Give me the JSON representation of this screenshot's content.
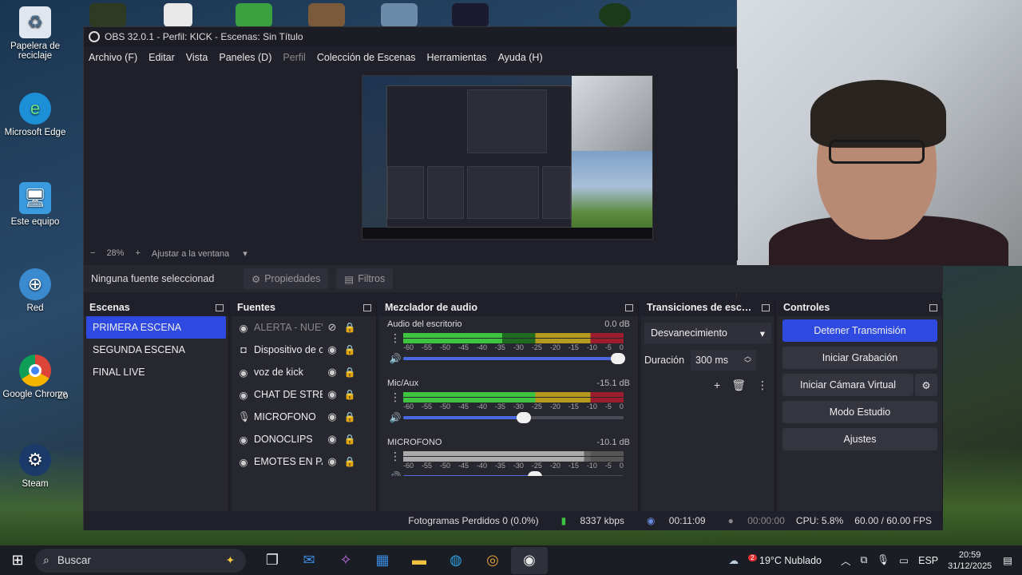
{
  "desktop": {
    "icons": [
      {
        "label": "Papelera de reciclaje",
        "icon": "recycle-bin-icon"
      },
      {
        "label": "Microsoft Edge",
        "icon": "edge-icon"
      },
      {
        "label": "Este equipo",
        "icon": "computer-icon"
      },
      {
        "label": "Red",
        "icon": "network-icon"
      },
      {
        "label": "Google Chrome",
        "icon": "chrome-icon"
      },
      {
        "label": "Steam",
        "icon": "steam-icon"
      }
    ],
    "partial_label": "Zo"
  },
  "obs": {
    "title": "OBS 32.0.1 - Perfil: KICK - Escenas: Sin Título",
    "menu": [
      "Archivo (F)",
      "Editar",
      "Vista",
      "Paneles (D)",
      "Perfil",
      "Colección de Escenas",
      "Herramientas",
      "Ayuda (H)"
    ],
    "zoom": {
      "minus": "−",
      "value": "28%",
      "plus": "+",
      "fit": "Ajustar a la ventana"
    },
    "props": {
      "no_source": "Ninguna fuente seleccionad",
      "properties": "Propiedades",
      "filters": "Filtros"
    },
    "scenes": {
      "title": "Escenas",
      "items": [
        "PRIMERA ESCENA",
        "SEGUNDA ESCENA",
        "FINAL LIVE"
      ]
    },
    "sources": {
      "title": "Fuentes",
      "items": [
        {
          "name": "ALERTA - NUEV",
          "icon": "browser-icon"
        },
        {
          "name": "Dispositivo de c",
          "icon": "camera-icon"
        },
        {
          "name": "voz de kick",
          "icon": "browser-icon"
        },
        {
          "name": "CHAT DE STREN",
          "icon": "browser-icon"
        },
        {
          "name": "MICROFONO",
          "icon": "mic-icon"
        },
        {
          "name": "DONOCLIPS",
          "icon": "browser-icon"
        },
        {
          "name": "EMOTES EN PA",
          "icon": "browser-icon"
        }
      ]
    },
    "mixer": {
      "title": "Mezclador de audio",
      "ticks": [
        "-60",
        "-55",
        "-50",
        "-45",
        "-40",
        "-35",
        "-30",
        "-25",
        "-20",
        "-15",
        "-10",
        "-5",
        "0"
      ],
      "channels": [
        {
          "name": "Audio del escritorio",
          "db": "0.0 dB",
          "level": 0.45,
          "volume": 0.98
        },
        {
          "name": "Mic/Aux",
          "db": "-15.1 dB",
          "level": 0.6,
          "volume": 0.55
        },
        {
          "name": "MICROFONO",
          "db": "-10.1 dB",
          "level": 0.82,
          "volume": 0.6
        }
      ]
    },
    "transitions": {
      "title": "Transiciones de esc…",
      "selected": "Desvanecimiento",
      "duration_label": "Duración",
      "duration_value": "300 ms"
    },
    "controls": {
      "title": "Controles",
      "stop_stream": "Detener Transmisión",
      "start_rec": "Iniciar Grabación",
      "virtual_cam": "Iniciar Cámara Virtual",
      "studio_mode": "Modo Estudio",
      "settings": "Ajustes"
    },
    "status": {
      "dropped": "Fotogramas Perdidos 0 (0.0%)",
      "bitrate": "8337 kbps",
      "stream_time": "00:11:09",
      "rec_time": "00:00:00",
      "cpu": "CPU: 5.8%",
      "fps": "60.00 / 60.00 FPS"
    }
  },
  "taskbar": {
    "search": "Buscar",
    "weather": "19°C  Nublado",
    "lang": "ESP",
    "time": "20:59",
    "date": "31/12/2025",
    "weather_badge": "2"
  },
  "colors": {
    "accent": "#2f4ae0",
    "meter_green": "#3ec43e",
    "meter_yellow": "#b59a1e",
    "meter_red": "#9c1e2e"
  }
}
